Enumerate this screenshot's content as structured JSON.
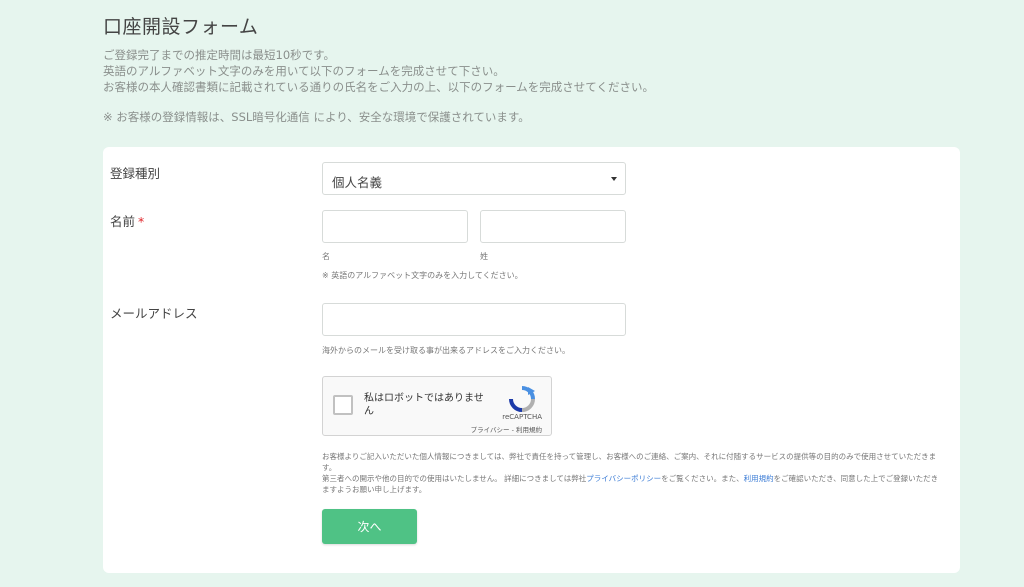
{
  "page": {
    "title": "口座開設フォーム",
    "intro_lines": [
      "ご登録完了までの推定時間は最短10秒です。",
      "英語のアルファベット文字のみを用いて以下のフォームを完成させて下さい。",
      "お客様の本人確認書類に記載されている通りの氏名をご入力の上、以下のフォームを完成させてください。"
    ],
    "ssl_note": "※ お客様の登録情報は、SSL暗号化通信 により、安全な環境で保護されています。"
  },
  "form": {
    "account_type": {
      "label": "登録種別",
      "selected": "個人名義"
    },
    "name": {
      "label": "名前",
      "required_mark": "*",
      "first_sub": "名",
      "last_sub": "姓",
      "note": "※ 英語のアルファベット文字のみを入力してください。",
      "first_value": "",
      "last_value": ""
    },
    "email": {
      "label": "メールアドレス",
      "value": "",
      "note": "海外からのメールを受け取る事が出来るアドレスをご入力ください。"
    },
    "captcha": {
      "checkbox_label": "私はロボットではありません",
      "brand": "reCAPTCHA",
      "links": "プライバシー - 利用規約"
    },
    "privacy": {
      "part1": "お客様よりご記入いただいた個人情報につきましては、弊社で責任を持って管理し、お客様へのご連絡、ご案内、それに付随するサービスの提供等の目的のみで使用させていただきます。",
      "part2": "第三者への開示や他の目的での使用はいたしません。 詳細につきましては弊社",
      "link1": "プライバシーポリシー",
      "part3": "をご覧ください。また、",
      "link2": "利用規約",
      "part4": "をご確認いただき、同意した上でご登録いただきますようお願い申し上げます。"
    },
    "next_label": "次へ"
  },
  "colors": {
    "background": "#e6f5ee",
    "button": "#4fc285",
    "required": "#e0262b",
    "link": "#3a7bd5"
  }
}
